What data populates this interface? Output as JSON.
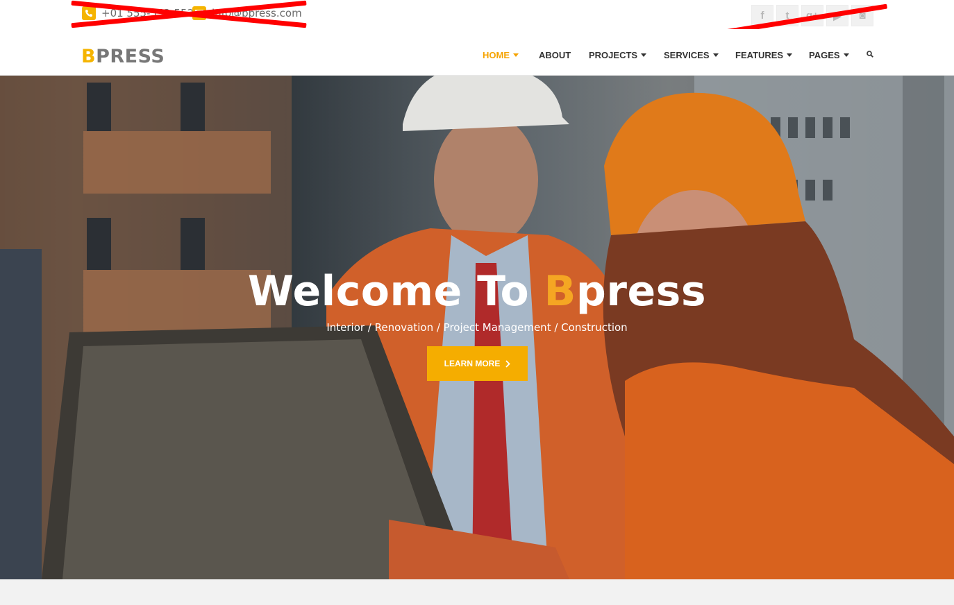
{
  "topbar": {
    "phone": "+01 555-553-552",
    "email": "info@bpress.com",
    "socials": [
      {
        "icon": "facebook-icon",
        "glyph": "f"
      },
      {
        "icon": "twitter-icon",
        "glyph": "t"
      },
      {
        "icon": "google-plus-icon",
        "glyph": "g+"
      },
      {
        "icon": "youtube-icon",
        "glyph": "▶"
      },
      {
        "icon": "instagram-icon",
        "glyph": "◙"
      }
    ]
  },
  "logo": {
    "first": "B",
    "rest": "PRESS"
  },
  "nav": {
    "items": [
      {
        "label": "HOME",
        "active": true,
        "dropdown": true
      },
      {
        "label": "ABOUT",
        "active": false,
        "dropdown": false
      },
      {
        "label": "PROJECTS",
        "active": false,
        "dropdown": true
      },
      {
        "label": "SERVICES",
        "active": false,
        "dropdown": true
      },
      {
        "label": "FEATURES",
        "active": false,
        "dropdown": true
      },
      {
        "label": "PAGES",
        "active": false,
        "dropdown": true
      }
    ],
    "search_icon": "search-icon"
  },
  "hero": {
    "title_prefix": "Welcome To ",
    "title_highlight": "B",
    "title_suffix": "press",
    "subtitle": "Interior / Renovation / Project Management / Construction",
    "button_label": "LEARN MORE"
  },
  "colors": {
    "accent": "#f5ad00",
    "nav_active": "#f5a300"
  }
}
